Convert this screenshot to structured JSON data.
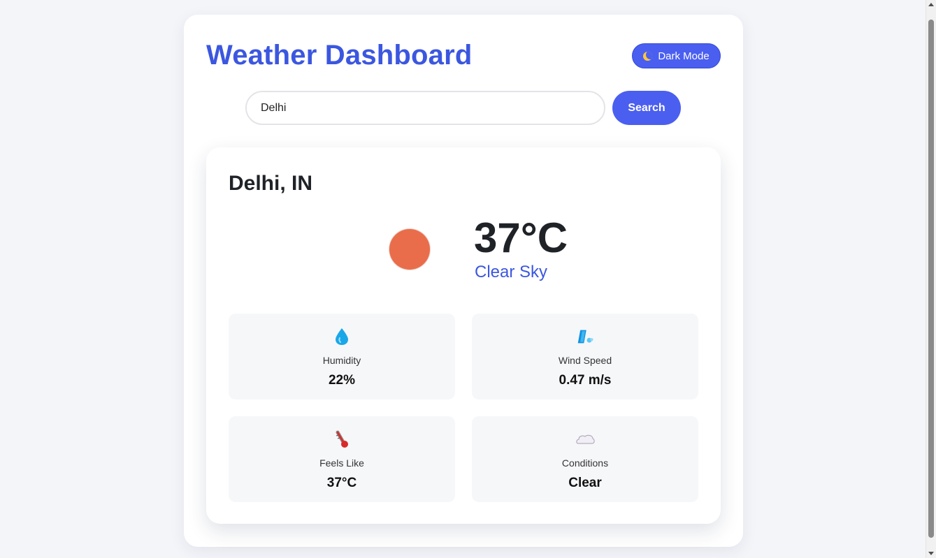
{
  "header": {
    "title": "Weather Dashboard",
    "dark_mode_label": "Dark Mode"
  },
  "search": {
    "value": "Delhi",
    "button_label": "Search"
  },
  "current": {
    "location": "Delhi, IN",
    "temperature": "37°C",
    "description": "Clear Sky"
  },
  "details": {
    "humidity": {
      "label": "Humidity",
      "value": "22%",
      "icon": "droplet-icon"
    },
    "wind": {
      "label": "Wind Speed",
      "value": "0.47 m/s",
      "icon": "wind-icon"
    },
    "feels_like": {
      "label": "Feels Like",
      "value": "37°C",
      "icon": "thermometer-icon"
    },
    "conditions": {
      "label": "Conditions",
      "value": "Clear",
      "icon": "cloud-icon"
    }
  },
  "colors": {
    "accent": "#4a5ff0",
    "title": "#3b57e0",
    "sun": "#e96d4a"
  }
}
